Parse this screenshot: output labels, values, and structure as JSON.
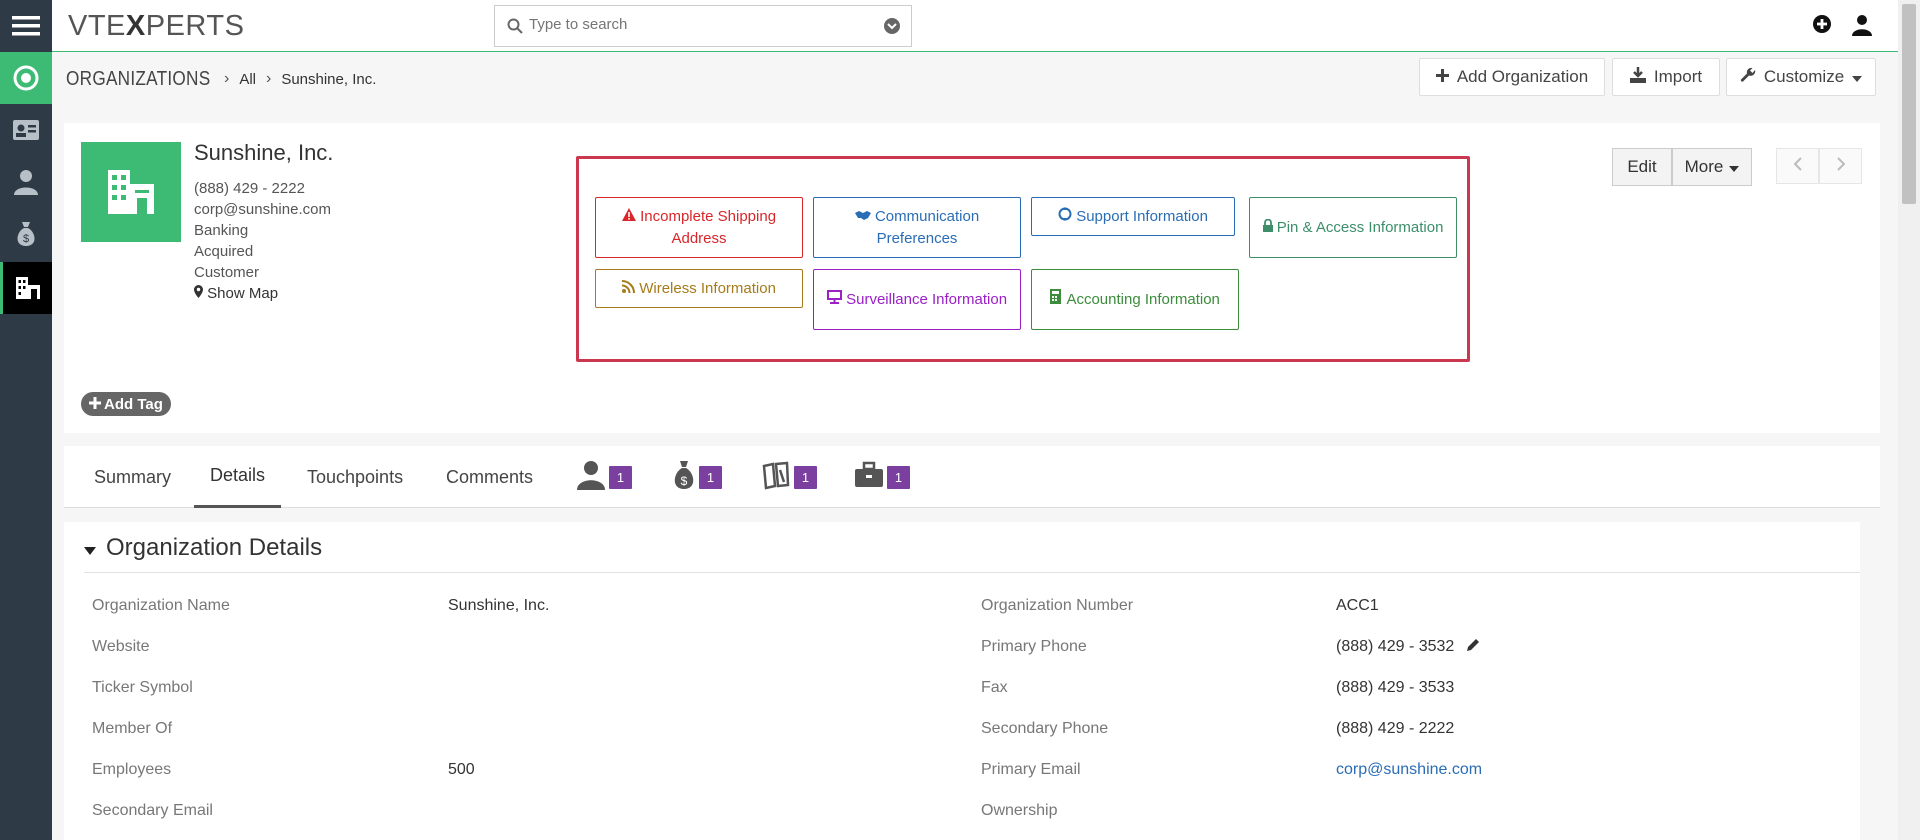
{
  "app": {
    "logo_prefix": "VTE",
    "logo_x": "X",
    "logo_suffix": "PERTS",
    "search_placeholder": "Type to search"
  },
  "rail": {
    "items": [
      "menu-icon",
      "dashboard-icon",
      "contact-card-icon",
      "person-icon",
      "money-bag-icon",
      "organization-icon"
    ]
  },
  "breadcrumb": {
    "module": "ORGANIZATIONS",
    "level1": "All",
    "level2": "Sunshine, Inc."
  },
  "header_buttons": {
    "add": "Add Organization",
    "import": "Import",
    "customize": "Customize"
  },
  "record": {
    "name": "Sunshine, Inc.",
    "phone": "(888) 429 - 2222",
    "email": "corp@sunshine.com",
    "industry": "Banking",
    "status": "Acquired",
    "type": "Customer",
    "show_map": "Show Map",
    "add_tag": "Add Tag"
  },
  "widgets": [
    {
      "label": "Incomplete Shipping Address",
      "color": "#d9262a",
      "icon": "warning-icon"
    },
    {
      "label": "Communication Preferences",
      "color": "#2a6db5",
      "icon": "handshake-icon"
    },
    {
      "label": "Support Information",
      "color": "#2a6db5",
      "icon": "support-icon"
    },
    {
      "label": "Pin & Access Information",
      "color": "#3d8f6a",
      "icon": "lock-icon"
    },
    {
      "label": "Wireless Information",
      "color": "#a67c1a",
      "icon": "wifi-icon"
    },
    {
      "label": "Surveillance Information",
      "color": "#9b21c6",
      "icon": "monitor-icon"
    },
    {
      "label": "Accounting Information",
      "color": "#3c8c3c",
      "icon": "accounting-icon"
    }
  ],
  "actions": {
    "edit": "Edit",
    "more": "More"
  },
  "tabs": {
    "summary": "Summary",
    "details": "Details",
    "touchpoints": "Touchpoints",
    "comments": "Comments",
    "contacts_count": "1",
    "deals_count": "1",
    "tickets_count": "1",
    "projects_count": "1"
  },
  "section": {
    "title": "Organization Details",
    "left_fields": [
      {
        "label": "Organization Name",
        "value": "Sunshine, Inc."
      },
      {
        "label": "Website",
        "value": ""
      },
      {
        "label": "Ticker Symbol",
        "value": ""
      },
      {
        "label": "Member Of",
        "value": ""
      },
      {
        "label": "Employees",
        "value": "500"
      },
      {
        "label": "Secondary Email",
        "value": ""
      }
    ],
    "right_fields": [
      {
        "label": "Organization Number",
        "value": "ACC1"
      },
      {
        "label": "Primary Phone",
        "value": "(888) 429 - 3532"
      },
      {
        "label": "Fax",
        "value": "(888) 429 - 3533"
      },
      {
        "label": "Secondary Phone",
        "value": "(888) 429 - 2222"
      },
      {
        "label": "Primary Email",
        "value": "corp@sunshine.com"
      },
      {
        "label": "Ownership",
        "value": ""
      }
    ]
  }
}
